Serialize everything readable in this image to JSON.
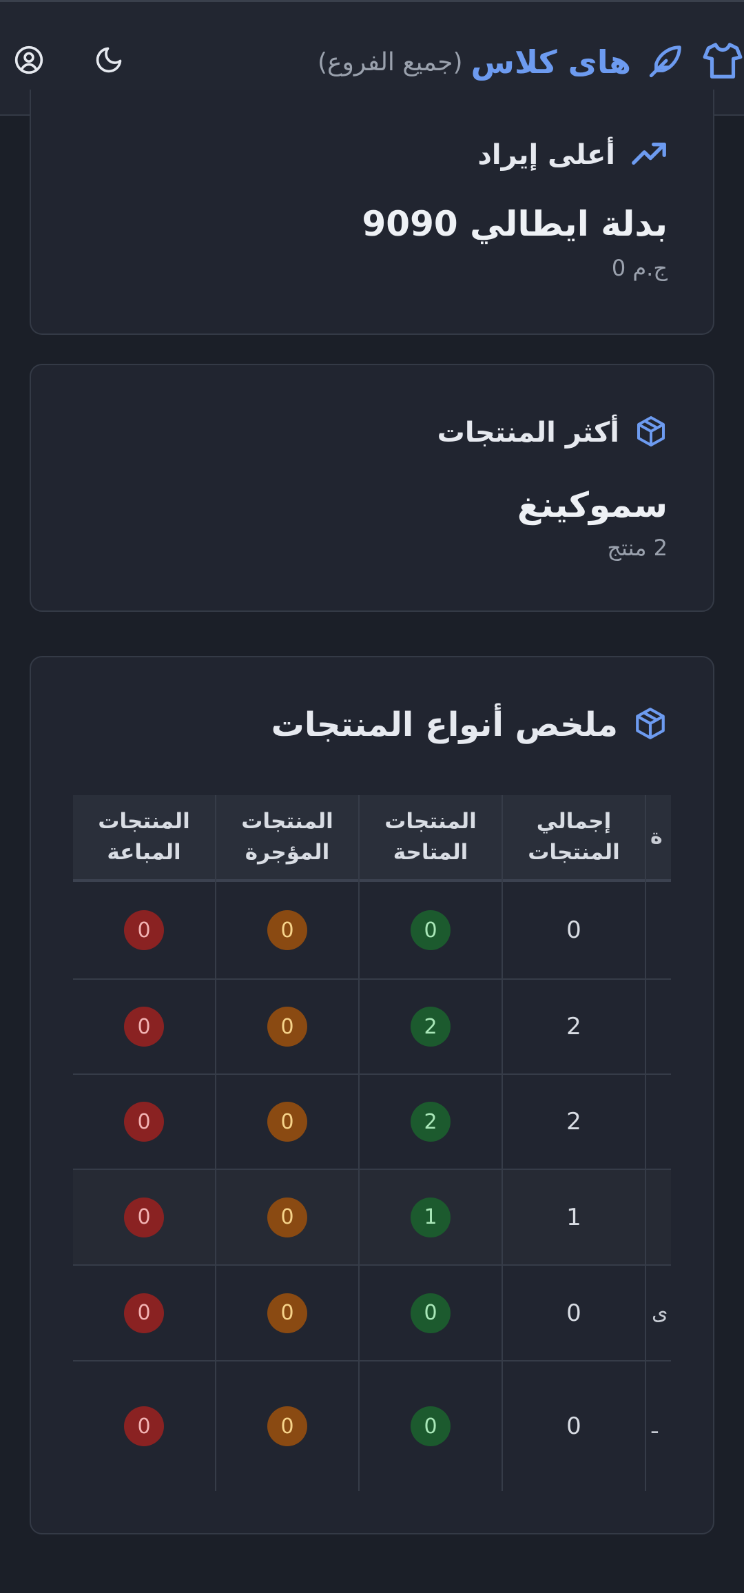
{
  "header": {
    "brand_name": "هاى كلاس",
    "brand_sub": "(جميع الفروع)",
    "icons": [
      "shirt-icon",
      "feather-icon",
      "moon-icon",
      "user-circle-icon"
    ]
  },
  "top_revenue": {
    "title": "أعلى إيراد",
    "product": "بدلة ايطالي 9090",
    "amount": "ج.م 0",
    "icon": "trending-up-icon"
  },
  "top_products": {
    "title": "أكثر المنتجات",
    "category": "سموكينغ",
    "count": "2 منتج",
    "icon": "box-icon"
  },
  "summary": {
    "title": "ملخص أنواع المنتجات",
    "icon": "box-icon",
    "columns": [
      "إجمالي المنتجات",
      "المنتجات المتاحة",
      "المنتجات المؤجرة",
      "المنتجات المباعة"
    ],
    "clipped_header": "ة",
    "rows": [
      {
        "total": "0",
        "available": "0",
        "rented": "0",
        "sold": "0",
        "clipped": ""
      },
      {
        "total": "2",
        "available": "2",
        "rented": "0",
        "sold": "0",
        "clipped": ""
      },
      {
        "total": "2",
        "available": "2",
        "rented": "0",
        "sold": "0",
        "clipped": ""
      },
      {
        "total": "1",
        "available": "1",
        "rented": "0",
        "sold": "0",
        "clipped": ""
      },
      {
        "total": "0",
        "available": "0",
        "rented": "0",
        "sold": "0",
        "clipped": "ى"
      },
      {
        "total": "0",
        "available": "0",
        "rented": "0",
        "sold": "0",
        "clipped": "ـ"
      }
    ]
  },
  "colors": {
    "accent": "#6d9bf0",
    "sold_badge": "#8a2222",
    "rented_badge": "#8a4a12",
    "available_badge": "#1c5a2e"
  }
}
